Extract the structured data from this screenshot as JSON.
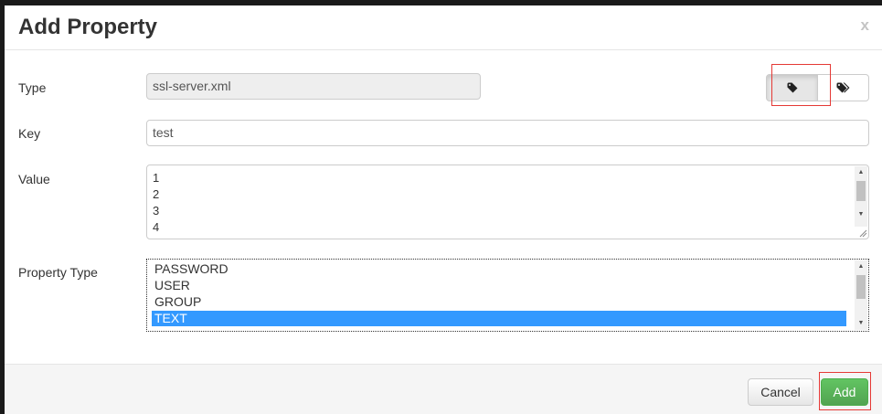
{
  "dialog": {
    "title": "Add Property",
    "close_label": "x"
  },
  "form": {
    "type_label": "Type",
    "type_value": "ssl-server.xml",
    "key_label": "Key",
    "key_value": "test",
    "value_label": "Value",
    "value_lines": [
      "1",
      "2",
      "3",
      "4"
    ],
    "property_type_label": "Property Type",
    "property_type_options": [
      "PASSWORD",
      "USER",
      "GROUP",
      "TEXT"
    ],
    "property_type_selected": "TEXT"
  },
  "toolbar": {
    "buttons": [
      {
        "icon": "tag-icon",
        "active": true
      },
      {
        "icon": "tags-icon",
        "active": false
      }
    ]
  },
  "footer": {
    "cancel_label": "Cancel",
    "add_label": "Add"
  },
  "colors": {
    "selection": "#3399ff",
    "add_button": "#5cb85c",
    "highlight_box": "#e53935",
    "readonly_bg": "#eeeeee"
  }
}
